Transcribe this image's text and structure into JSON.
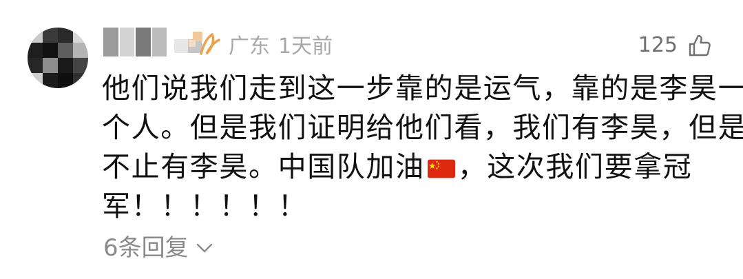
{
  "comment": {
    "location": "广东",
    "time_ago": "1天前",
    "like_count": "125",
    "text_lines": [
      "他们说我们走到这一步靠的是运气，靠的是李昊一",
      "个人。但是我们证明给他们看，我们有李昊，但是",
      "不止有李昊。中国队加油",
      "，这次我们要拿冠",
      "军！！！！！！"
    ],
    "reply_label": "6条回复"
  },
  "colors": {
    "meta_text": "#a8a8a8",
    "body_text": "#111111",
    "reply_text": "#8a8a8a",
    "flag_red": "#de2910",
    "flag_yellow": "#ffde00"
  },
  "icons": {
    "like": "thumbs-up-icon",
    "reply_expand": "chevron-down-icon",
    "flag": "china-flag-emoji"
  }
}
